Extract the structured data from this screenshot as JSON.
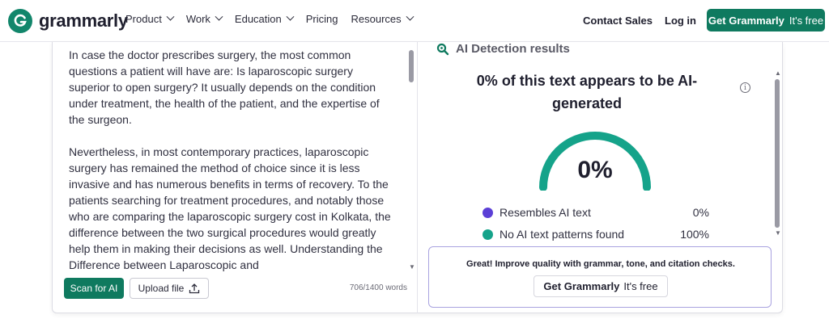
{
  "nav": {
    "brand": "grammarly",
    "menu": [
      "Product",
      "Work",
      "Education",
      "Pricing",
      "Resources"
    ],
    "menu_has_chevron": [
      true,
      true,
      true,
      false,
      true
    ],
    "contact": "Contact Sales",
    "login": "Log in",
    "cta_main": "Get Grammarly",
    "cta_sub": "It's free",
    "brand_color": "#12866b"
  },
  "editor": {
    "paragraphs": [
      "In case the doctor prescribes surgery, the most common questions a patient will have are: Is laparoscopic surgery superior to open surgery? It usually depends on the condition under treatment, the health of the patient, and the expertise of the surgeon.",
      "Nevertheless, in most contemporary practices, laparoscopic surgery has remained the method of choice since it is less invasive and has numerous benefits in terms of recovery. To the patients searching for treatment procedures, and notably those who are comparing the laparoscopic surgery cost in Kolkata, the difference between the two surgical procedures would greatly help them in making their decisions as well. Understanding the Difference between Laparoscopic and"
    ],
    "scan_button": "Scan for AI",
    "upload_button": "Upload file",
    "word_count": "706/1400 words"
  },
  "results": {
    "title": "AI Detection results",
    "headline": "0% of this text appears to be AI-generated",
    "gauge_value": "0%",
    "gauge_fraction": 0,
    "legend": [
      {
        "label": "Resembles AI text",
        "value": "0%",
        "color": "#5b3fd6"
      },
      {
        "label": "No AI text patterns found",
        "value": "100%",
        "color": "#15a38a"
      }
    ],
    "promo_text": "Great! Improve quality with grammar, tone, and citation checks.",
    "promo_button_main": "Get Grammarly",
    "promo_button_sub": "It's free"
  }
}
